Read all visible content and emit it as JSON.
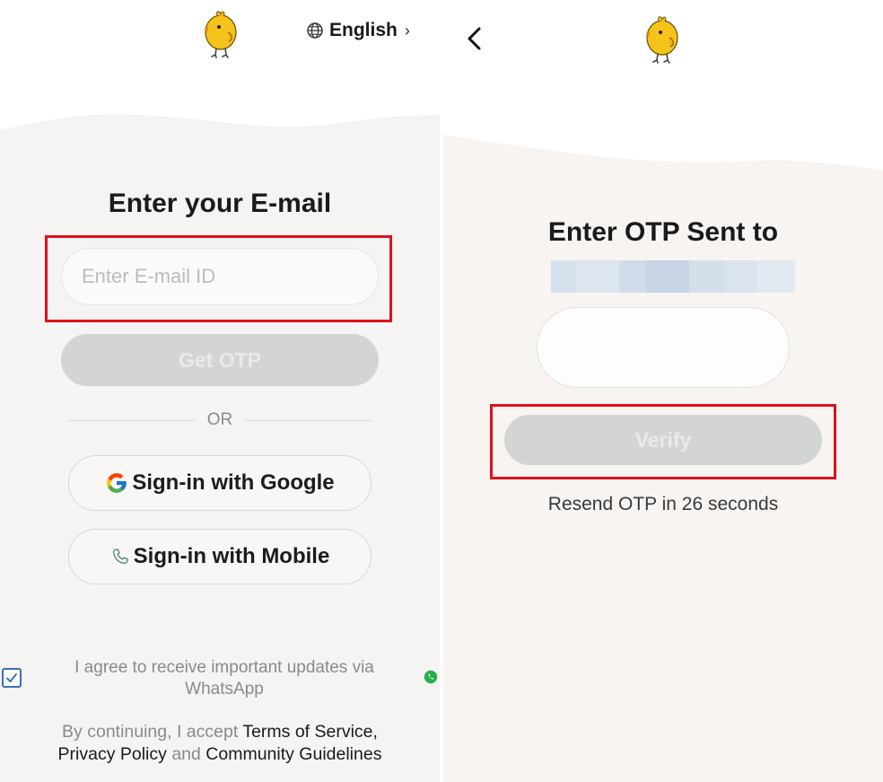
{
  "email_screen": {
    "language_label": "English",
    "heading": "Enter your E-mail",
    "email_input": {
      "value": "",
      "placeholder": "Enter E-mail ID"
    },
    "get_otp_label": "Get OTP",
    "divider_text": "OR",
    "google_button_label": "Sign-in with Google",
    "mobile_button_label": "Sign-in with Mobile",
    "whatsapp_consent": {
      "checked": true,
      "text": "I agree to receive important updates via WhatsApp"
    },
    "legal": {
      "prefix": "By continuing, I accept ",
      "terms": "Terms of Service",
      "comma": ",",
      "privacy": "Privacy Policy",
      "and": " and ",
      "guidelines": "Community Guidelines"
    }
  },
  "otp_screen": {
    "heading": "Enter OTP Sent to",
    "otp_input": {
      "value": ""
    },
    "verify_label": "Verify",
    "resend_text": "Resend OTP in 26 seconds"
  },
  "icons": {
    "logo": "chick-logo-icon",
    "language": "globe-icon",
    "language_chevron": "chevron-right-icon",
    "google": "google-g-icon",
    "mobile": "phone-icon",
    "whatsapp": "whatsapp-icon",
    "back": "chevron-left-icon",
    "checkbox": "checkmark-icon"
  },
  "colors": {
    "highlight_border": "#e0101a",
    "logo_yellow": "#f6c21c",
    "disabled_button_bg": "#d2d5d2",
    "checkbox_blue": "#3d6fb3",
    "whatsapp_green": "#25b04a"
  }
}
